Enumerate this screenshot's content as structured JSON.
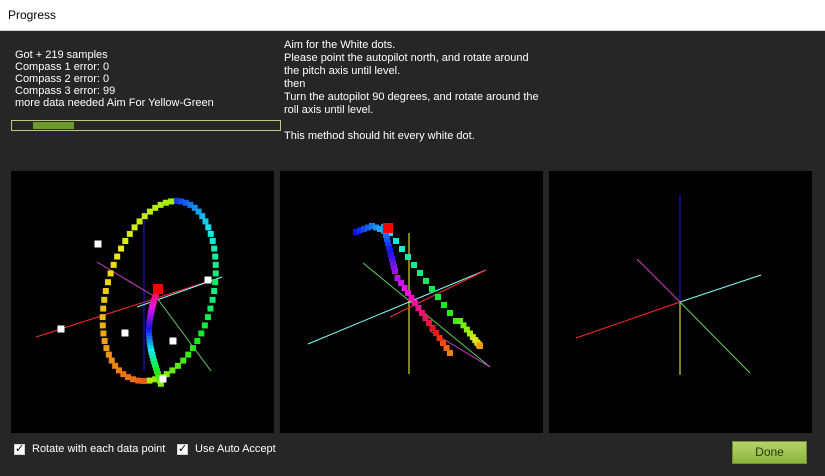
{
  "window": {
    "title": "Progress"
  },
  "status": {
    "lines": [
      "Got + 219 samples",
      "Compass 1 error: 0",
      "Compass 2 error: 0",
      "Compass 3 error: 99",
      "more data needed Aim For Yellow-Green"
    ]
  },
  "progress": {
    "fill_start_fraction": 0.08,
    "fill_end_fraction": 0.23,
    "border_color": "#b7c97a",
    "fill_color": "#6d9a2a"
  },
  "instructions": {
    "text": "Aim for the White dots.\nPlease point the autopilot north, and rotate around the pitch axis until level.\nthen\nTurn the autopilot 90 degrees, and rotate around the roll axis until level.\n\nThis method should hit every white dot."
  },
  "plots": [
    {
      "name": "compass-1-plot",
      "has_samples": true
    },
    {
      "name": "compass-2-plot",
      "has_samples": true
    },
    {
      "name": "compass-3-plot",
      "has_samples": false
    }
  ],
  "options": {
    "rotate_label": "Rotate with each data point",
    "rotate_checked": true,
    "auto_accept_label": "Use Auto Accept",
    "auto_accept_checked": true
  },
  "done_button": {
    "label": "Done"
  },
  "colors": {
    "background": "#262626",
    "plot_background": "#000000",
    "axis_red": "#ff2a2a",
    "axis_cyan": "#7fffff",
    "axis_blue": "#1e1ee6",
    "axis_yellow": "#ffff40",
    "axis_green": "#60d060",
    "axis_magenta": "#d040d0",
    "target_dot": "#ffffff",
    "current_sample": "#ff0000"
  }
}
